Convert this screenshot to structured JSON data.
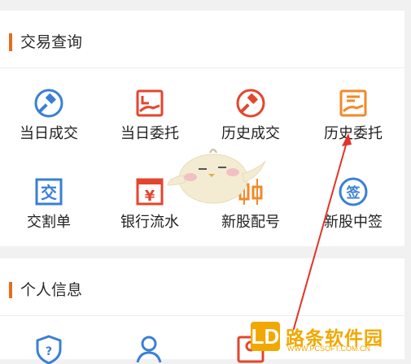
{
  "trade_section": {
    "title": "交易查询",
    "items": [
      {
        "label": "当日成交",
        "icon": "hammer-circle-icon",
        "color": "#3a7fd5"
      },
      {
        "label": "当日委托",
        "icon": "hand-document-icon",
        "color": "#e3462d"
      },
      {
        "label": "历史成交",
        "icon": "hammer-circle-icon",
        "color": "#e3462d"
      },
      {
        "label": "历史委托",
        "icon": "hand-document-icon",
        "color": "#f08a2a"
      },
      {
        "label": "交割单",
        "icon": "delivery-slip-icon",
        "color": "#3a7fd5"
      },
      {
        "label": "银行流水",
        "icon": "yuan-ledger-icon",
        "color": "#e3462d"
      },
      {
        "label": "新股配号",
        "icon": "candlestick-icon",
        "color": "#f08a2a"
      },
      {
        "label": "新股中签",
        "icon": "lottery-sign-icon",
        "color": "#3a7fd5"
      }
    ]
  },
  "personal_section": {
    "title": "个人信息",
    "items": [
      {
        "icon": "shield-icon",
        "color": "#3a7fd5"
      },
      {
        "icon": "user-icon",
        "color": "#3a7fd5"
      },
      {
        "icon": "profile-card-icon",
        "color": "#e3462d"
      }
    ]
  },
  "mascot": {
    "icon": "chick-mascot-icon"
  },
  "watermark": {
    "text": "路条软件园",
    "box_letter": "LD",
    "url": "WWW.PCSOFT.COM.CN",
    "color": "#f2a800"
  },
  "annotation": {
    "color": "#e0342a"
  }
}
